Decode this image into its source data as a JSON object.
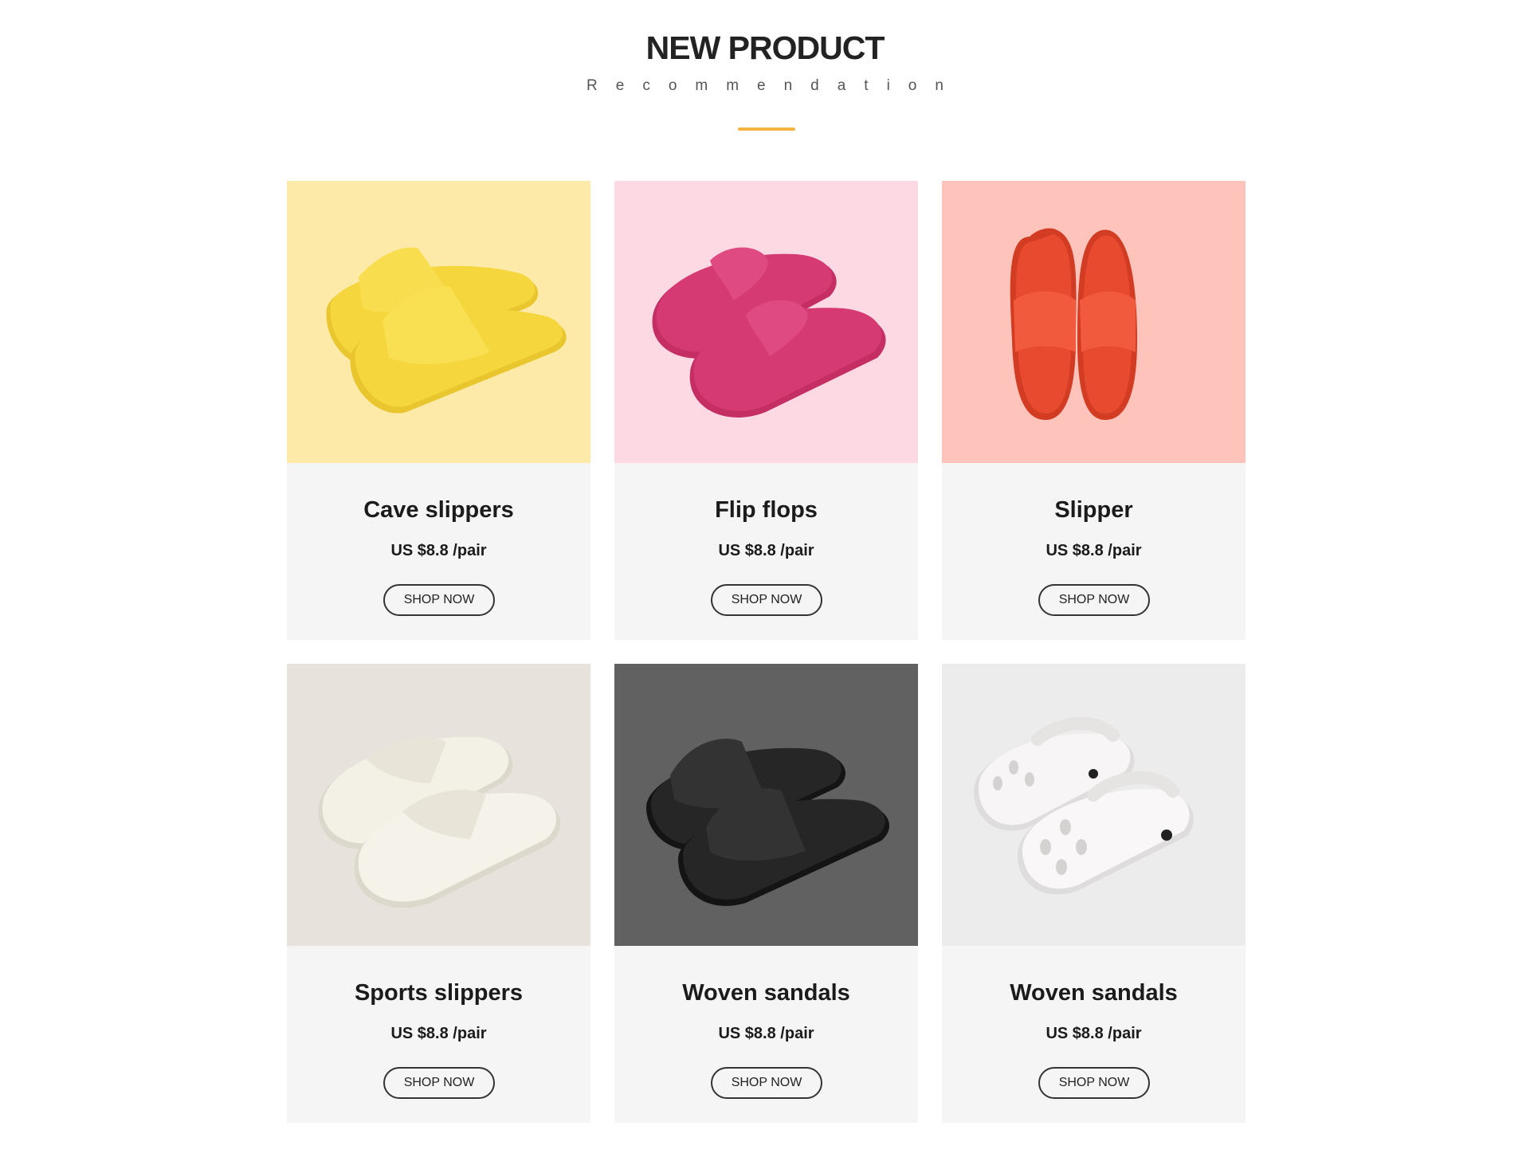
{
  "section": {
    "title": "NEW PRODUCT",
    "subtitle": "Recommendation",
    "accent_color": "#f5b442"
  },
  "products": [
    {
      "name": "Cave slippers",
      "price": "US $8.8 /pair",
      "button_label": "SHOP NOW",
      "image_bg": "#fdeaa9",
      "shoe_color": "#f5d63c",
      "image_icon": "yellow-slide-sandal-image"
    },
    {
      "name": "Flip flops",
      "price": "US $8.8 /pair",
      "button_label": "SHOP NOW",
      "image_bg": "#fdd9e4",
      "shoe_color": "#d63a72",
      "image_icon": "pink-flip-flop-image"
    },
    {
      "name": "Slipper",
      "price": "US $8.8 /pair",
      "button_label": "SHOP NOW",
      "image_bg": "#fec4bb",
      "shoe_color": "#e84a30",
      "image_icon": "red-slipper-image"
    },
    {
      "name": "Sports slippers",
      "price": "US $8.8 /pair",
      "button_label": "SHOP NOW",
      "image_bg": "#e7e2dc",
      "shoe_color": "#f3f0e6",
      "image_icon": "white-flip-flop-image"
    },
    {
      "name": "Woven sandals",
      "price": "US $8.8 /pair",
      "button_label": "SHOP NOW",
      "image_bg": "#616161",
      "shoe_color": "#1f1f1f",
      "image_icon": "black-slide-sandal-image"
    },
    {
      "name": "Woven sandals",
      "price": "US $8.8 /pair",
      "button_label": "SHOP NOW",
      "image_bg": "#ececec",
      "shoe_color": "#f7f5f5",
      "image_icon": "white-clog-image"
    }
  ]
}
